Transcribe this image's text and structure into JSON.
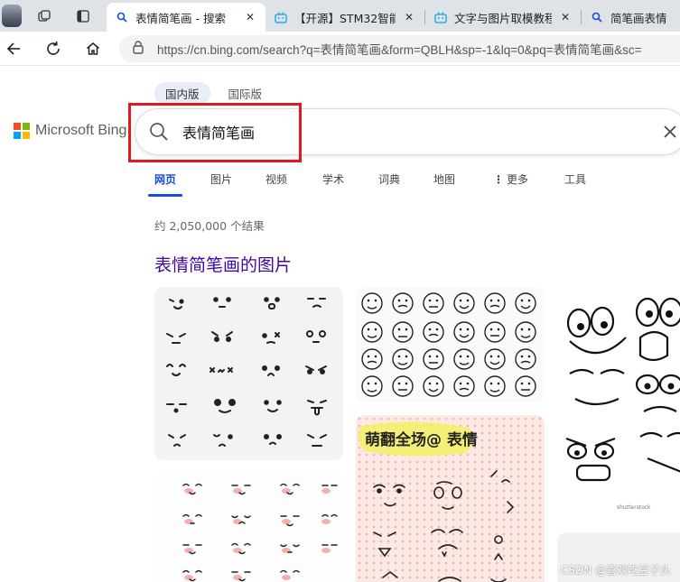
{
  "browser": {
    "tabs": [
      {
        "title": "表情简笔画 - 搜索",
        "active": true
      },
      {
        "title": "【开源】STM32智能",
        "active": false
      },
      {
        "title": "文字与图片取模教程_",
        "active": false
      },
      {
        "title": "简笔画表情 -",
        "active": false
      }
    ],
    "url": "https://cn.bing.com/search?q=表情简笔画&form=QBLH&sp=-1&lq=0&pq=表情简笔画&sc=",
    "colors": {
      "tab_bar": "#dfe3e8",
      "bilibili_blue": "#23ade5"
    }
  },
  "bing": {
    "logo_text": "Microsoft Bing",
    "logo_colors": [
      "#f25022",
      "#7fba00",
      "#00a4ef",
      "#ffb900"
    ],
    "region_tabs": [
      {
        "label": "国内版",
        "selected": true
      },
      {
        "label": "国际版",
        "selected": false
      }
    ],
    "search": {
      "query": "表情简笔画"
    },
    "scope_tabs": [
      {
        "label": "网页",
        "selected": true
      },
      {
        "label": "图片",
        "selected": false
      },
      {
        "label": "视频",
        "selected": false
      },
      {
        "label": "学术",
        "selected": false
      },
      {
        "label": "词典",
        "selected": false
      },
      {
        "label": "地图",
        "selected": false
      },
      {
        "label": "更多",
        "selected": false
      },
      {
        "label": "工具",
        "selected": false
      }
    ],
    "result_count": "约 2,050,000 个结果",
    "images_title": "表情简笔画的图片",
    "image_tiles": [
      {
        "name": "kaomoji-faces-grid",
        "caption": ""
      },
      {
        "name": "round-emoji-doodles",
        "caption": ""
      },
      {
        "name": "cartoon-eyes-mouths",
        "caption": ""
      },
      {
        "name": "blush-faces-rows",
        "caption": ""
      },
      {
        "name": "cute-expression-poster",
        "caption": "萌翻全场@ 表情"
      },
      {
        "name": "partial-tile",
        "caption": ""
      }
    ],
    "accent": "#174ae4",
    "title_color": "#4007a2"
  },
  "watermark": "CSDN @喜欢吃豆子头"
}
